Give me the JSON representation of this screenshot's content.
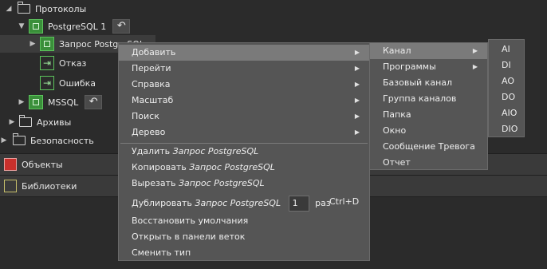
{
  "tree": {
    "protocols_label": "Протоколы",
    "postgres1_label": "PostgreSQL 1",
    "postgres_request_label": "Запрос PostgreSQL",
    "deny_label": "Отказ",
    "error_label": "Ошибка",
    "mssql_label": "MSSQL",
    "archives_label": "Архивы",
    "security_label": "Безопасность"
  },
  "sections": {
    "objects_label": "Объекты",
    "libraries_label": "Библиотеки"
  },
  "context_menu": {
    "add": "Добавить",
    "goto": "Перейти",
    "help": "Справка",
    "scale": "Масштаб",
    "search": "Поиск",
    "tree": "Дерево",
    "delete_prefix": "Удалить",
    "delete_target": "Запрос PostgreSQL",
    "copy_prefix": "Копировать",
    "copy_target": "Запрос PostgreSQL",
    "cut_prefix": "Вырезать",
    "cut_target": "Запрос PostgreSQL",
    "duplicate_prefix": "Дублировать",
    "duplicate_target": "Запрос PostgreSQL",
    "duplicate_count": "1",
    "duplicate_unit": "раз",
    "duplicate_shortcut": "Ctrl+D",
    "restore_defaults": "Восстановить умолчания",
    "open_in_branch_panel": "Открыть в панели веток",
    "change_type": "Сменить тип"
  },
  "add_submenu": {
    "channel": "Канал",
    "programs": "Программы",
    "base_channel": "Базовый канал",
    "channel_group": "Группа каналов",
    "folder": "Папка",
    "window": "Окно",
    "alarm_message": "Сообщение Тревога",
    "report": "Отчет"
  },
  "channel_submenu": [
    "AI",
    "DI",
    "AO",
    "DO",
    "AIO",
    "DIO"
  ],
  "colors": {
    "background": "#2b2b2b",
    "menu_bg": "#555555",
    "highlight": "#7a7a7a",
    "accent_green": "#3a8f3a"
  }
}
